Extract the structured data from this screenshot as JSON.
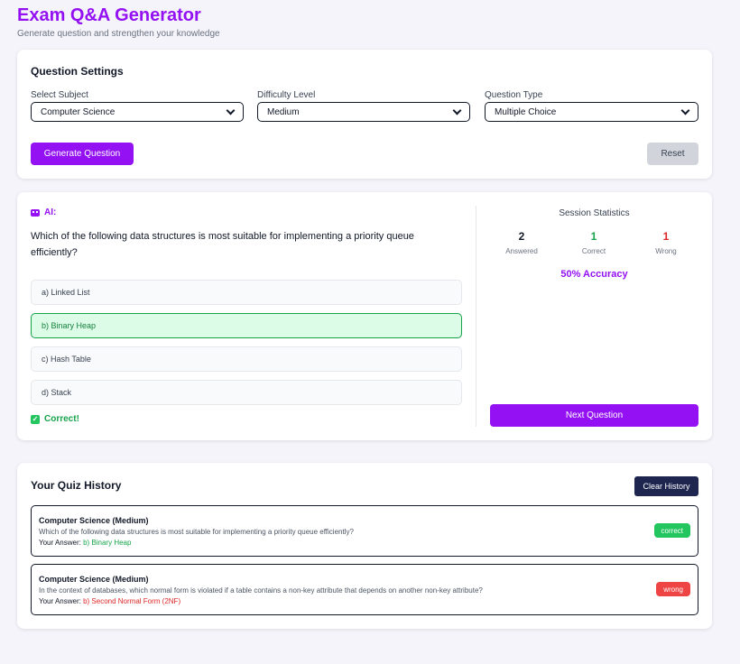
{
  "app": {
    "title": "Exam Q&A Generator",
    "subtitle": "Generate question and strengthen your knowledge"
  },
  "settings": {
    "title": "Question Settings",
    "subject": {
      "label": "Select Subject",
      "value": "Computer Science"
    },
    "difficulty": {
      "label": "Difficulty Level",
      "value": "Medium"
    },
    "type": {
      "label": "Question Type",
      "value": "Multiple Choice"
    },
    "generate_label": "Generate Question",
    "reset_label": "Reset"
  },
  "qa": {
    "ai_label": "AI:",
    "question": "Which of the following data structures is most suitable for implementing a priority queue efficiently?",
    "options": [
      {
        "label": "a) Linked List",
        "state": "default"
      },
      {
        "label": "b) Binary Heap",
        "state": "correct-selected"
      },
      {
        "label": "c) Hash Table",
        "state": "default"
      },
      {
        "label": "d) Stack",
        "state": "default"
      }
    ],
    "feedback": "Correct!",
    "next_label": "Next Question"
  },
  "stats": {
    "title": "Session Statistics",
    "answered": {
      "value": "2",
      "label": "Answered"
    },
    "correct": {
      "value": "1",
      "label": "Correct"
    },
    "wrong": {
      "value": "1",
      "label": "Wrong"
    },
    "accuracy": "50% Accuracy"
  },
  "history": {
    "title": "Your Quiz History",
    "clear_label": "Clear History",
    "items": [
      {
        "title": "Computer Science (Medium)",
        "question": "Which of the following data structures is most suitable for implementing a priority queue efficiently?",
        "answer_prefix": "Your Answer:",
        "answer": "b) Binary Heap",
        "result": "correct"
      },
      {
        "title": "Computer Science (Medium)",
        "question": "In the context of databases, which normal form is violated if a table contains a non-key attribute that depends on another non-key attribute?",
        "answer_prefix": "Your Answer:",
        "answer": "b) Second Normal Form (2NF)",
        "result": "wrong"
      }
    ]
  },
  "colors": {
    "accent": "#9311f2",
    "correct": "#16a34a",
    "wrong": "#dc2626",
    "navy": "#1e2650"
  }
}
